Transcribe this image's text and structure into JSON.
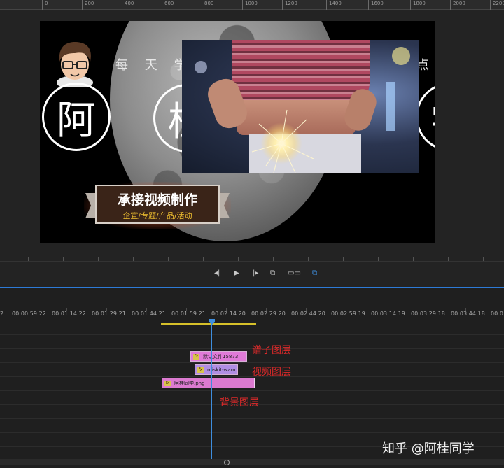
{
  "ruler": {
    "labels": [
      "0",
      "200",
      "400",
      "600",
      "800",
      "1000",
      "1200",
      "1400",
      "1600",
      "1800",
      "2000",
      "2200"
    ]
  },
  "canvas": {
    "headline": "每 天 学",
    "headline_end": "点",
    "circle_chars": [
      "阿",
      "桂",
      "学"
    ],
    "banner_title": "承接视频制作",
    "banner_subtitle": "企宣/专题/产品/活动"
  },
  "controls": {
    "step_back": "◂|",
    "play": "▶",
    "step_forward": "|▸",
    "insert": "⧉",
    "overwrite": "▭▭",
    "export_frame": "⧉"
  },
  "timeline": {
    "timecodes": [
      "2",
      "00:00:59:22",
      "00:01:14:22",
      "00:01:29:21",
      "00:01:44:21",
      "00:01:59:21",
      "00:02:14:20",
      "00:02:29:20",
      "00:02:44:20",
      "00:02:59:19",
      "00:03:14:19",
      "00:03:29:18",
      "00:03:44:18",
      "00:0"
    ],
    "clips": [
      {
        "fx": "fx",
        "name": "默认文件15873"
      },
      {
        "fx": "fx",
        "name": "miskit-wam"
      },
      {
        "fx": "fx",
        "name": "阿桂同学.png"
      }
    ],
    "annotations": {
      "layer_a": "谱子图层",
      "layer_b": "视频图层",
      "layer_c": "背景图层"
    }
  },
  "watermark": "知乎 @阿桂同学",
  "colors": {
    "accent": "#2d7ad6",
    "annotation": "#e02a2a",
    "work_area": "#d6c02a"
  }
}
